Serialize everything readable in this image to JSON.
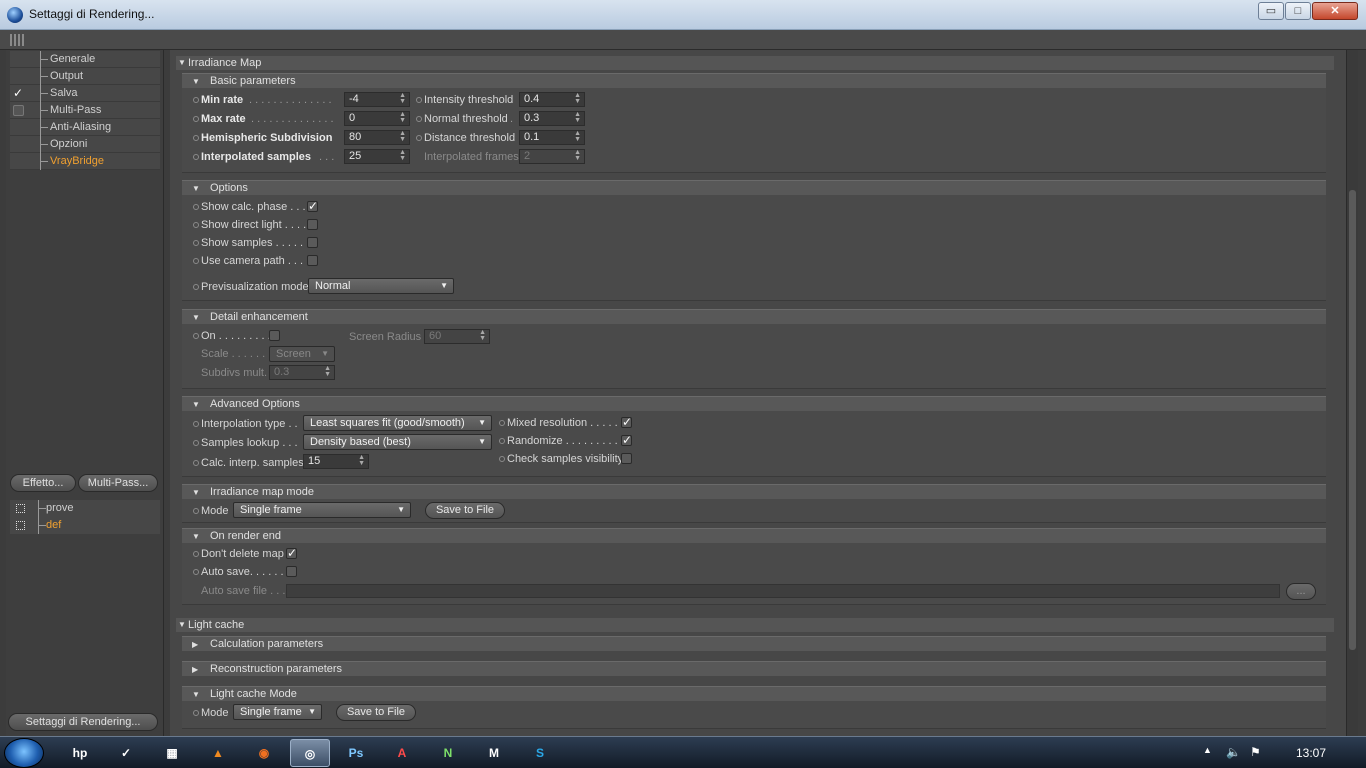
{
  "window": {
    "title": "Settaggi di Rendering...",
    "min": "▭",
    "max": "□",
    "close": "✕"
  },
  "left": {
    "nav": [
      {
        "label": "Generale",
        "checked": false,
        "box": false,
        "highlight": false
      },
      {
        "label": "Output",
        "checked": false,
        "box": false,
        "highlight": false
      },
      {
        "label": "Salva",
        "checked": true,
        "box": false,
        "highlight": false
      },
      {
        "label": "Multi-Pass",
        "checked": false,
        "box": true,
        "highlight": false
      },
      {
        "label": "Anti-Aliasing",
        "checked": false,
        "box": false,
        "highlight": false
      },
      {
        "label": "Opzioni",
        "checked": false,
        "box": false,
        "highlight": false
      },
      {
        "label": "VrayBridge",
        "checked": false,
        "box": false,
        "highlight": true
      }
    ],
    "effetto_btn": "Effetto...",
    "multipass_btn": "Multi-Pass...",
    "settings": [
      {
        "label": "prove",
        "highlight": false
      },
      {
        "label": "def",
        "highlight": true
      }
    ],
    "bottom_btn": "Settaggi di Rendering..."
  },
  "irradiance": {
    "title": "Irradiance Map",
    "basic": {
      "title": "Basic parameters",
      "min_rate": {
        "label": "Min rate",
        "dots": " . . . . . . . . . . . . . .",
        "value": "-4"
      },
      "max_rate": {
        "label": "Max rate",
        "dots": " . . . . . . . . . . . . . .",
        "value": "0"
      },
      "hemi": {
        "label": "Hemispheric Subdivision",
        "value": "80"
      },
      "interp": {
        "label": "Interpolated samples",
        "dots": " . . .",
        "value": "25"
      },
      "intensity": {
        "label": "Intensity threshold",
        "value": "0.4"
      },
      "normal": {
        "label": "Normal threshold",
        "dots": " .",
        "value": "0.3"
      },
      "distance": {
        "label": "Distance threshold",
        "value": "0.1"
      },
      "frames": {
        "label": "Interpolated frames",
        "value": "2"
      }
    },
    "options": {
      "title": "Options",
      "show_calc": {
        "label": "Show calc. phase . . .",
        "checked": "✓"
      },
      "show_direct": {
        "label": "Show direct light . . . ."
      },
      "show_samples": {
        "label": "Show samples . . . . ."
      },
      "use_camera": {
        "label": "Use camera path . . ."
      },
      "previs": {
        "label": "Previsualization mode",
        "value": "Normal"
      }
    },
    "detail": {
      "title": "Detail enhancement",
      "on": {
        "label": "On . . . . . . . . ."
      },
      "screen_radius": {
        "label": "Screen Radius",
        "value": "60"
      },
      "scale": {
        "label": "Scale . . . . . . .",
        "value": "Screen"
      },
      "subdivs": {
        "label": "Subdivs mult.",
        "value": "0.3"
      }
    },
    "advanced": {
      "title": "Advanced Options",
      "interp_type": {
        "label": "Interpolation type . .",
        "value": "Least squares fit (good/smooth)"
      },
      "samples_lookup": {
        "label": "Samples lookup . . .",
        "value": "Density based (best)"
      },
      "calc_interp": {
        "label": "Calc. interp. samples",
        "value": "15"
      },
      "mixed": {
        "label": "Mixed resolution . . . . . .",
        "checked": "✓"
      },
      "randomize": {
        "label": "Randomize . . . . . . . . . .",
        "checked": "✓"
      },
      "check_vis": {
        "label": "Check samples visibility"
      }
    },
    "mode": {
      "title": "Irradiance map mode",
      "label": "Mode",
      "value": "Single frame",
      "save": "Save to File"
    },
    "render_end": {
      "title": "On render end",
      "dont_delete": {
        "label": "Don't delete map",
        "checked": "✓"
      },
      "auto_save": {
        "label": "Auto save. . . . . ."
      },
      "auto_file": {
        "label": "Auto save file . . .",
        "browse": "..."
      }
    }
  },
  "light_cache": {
    "title": "Light cache",
    "calc": "Calculation parameters",
    "recon": "Reconstruction parameters",
    "mode": {
      "title": "Light cache Mode",
      "label": "Mode",
      "value": "Single frame",
      "save": "Save to File"
    }
  },
  "taskbar": {
    "clock": "13:07",
    "apps": [
      "hp",
      "✓",
      "▦",
      "▲",
      "◉",
      "◎",
      "Ps",
      "A",
      "N",
      "M",
      "S"
    ]
  },
  "icons": {
    "spin": "▲▼",
    "drop": "▼",
    "tri_open": "▼",
    "tri_closed": "▶",
    "check": "✓",
    "vol": "🔈",
    "flag": "⚑",
    "up": "▲"
  }
}
